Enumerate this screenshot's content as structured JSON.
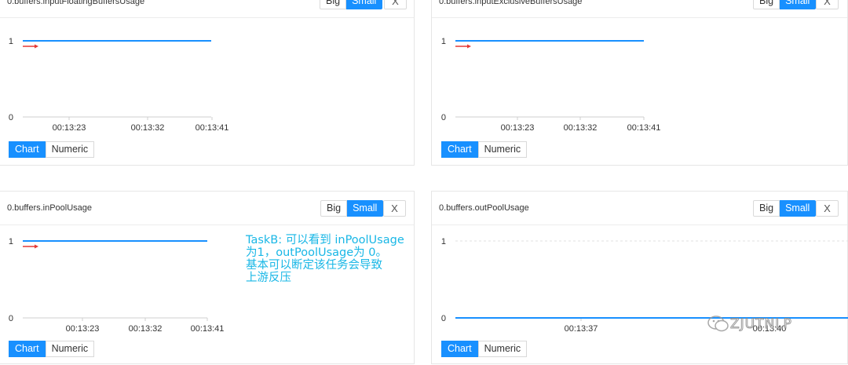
{
  "panels": [
    {
      "title": "0.buffers.inputFloatingBuffersUsage",
      "view_size": {
        "big": "Big",
        "small": "Small",
        "selected": "Small"
      },
      "close": "X",
      "chart_data": {
        "type": "line",
        "y_ticks": [
          "1",
          "0"
        ],
        "x_ticks": [
          "00:13:23",
          "00:13:32",
          "00:13:41"
        ],
        "ylim": [
          0,
          1
        ],
        "series": [
          {
            "values": [
              1,
              1
            ]
          }
        ],
        "line_color": "#1890ff",
        "marker": "red-arrow"
      },
      "view_mode": {
        "chart": "Chart",
        "numeric": "Numeric",
        "selected": "Chart"
      }
    },
    {
      "title": "0.buffers.inputExclusiveBuffersUsage",
      "view_size": {
        "big": "Big",
        "small": "Small",
        "selected": "Small"
      },
      "close": "X",
      "chart_data": {
        "type": "line",
        "y_ticks": [
          "1",
          "0"
        ],
        "x_ticks": [
          "00:13:23",
          "00:13:32",
          "00:13:41"
        ],
        "ylim": [
          0,
          1
        ],
        "series": [
          {
            "values": [
              1,
              1
            ]
          }
        ],
        "line_color": "#1890ff",
        "marker": "red-arrow"
      },
      "view_mode": {
        "chart": "Chart",
        "numeric": "Numeric",
        "selected": "Chart"
      }
    },
    {
      "title": "0.buffers.inPoolUsage",
      "view_size": {
        "big": "Big",
        "small": "Small",
        "selected": "Small"
      },
      "close": "X",
      "chart_data": {
        "type": "line",
        "y_ticks": [
          "1",
          "0"
        ],
        "x_ticks": [
          "00:13:23",
          "00:13:32",
          "00:13:41"
        ],
        "ylim": [
          0,
          1
        ],
        "series": [
          {
            "values": [
              1,
              1
            ]
          }
        ],
        "line_color": "#1890ff",
        "marker": "red-arrow"
      },
      "view_mode": {
        "chart": "Chart",
        "numeric": "Numeric",
        "selected": "Chart"
      }
    },
    {
      "title": "0.buffers.outPoolUsage",
      "view_size": {
        "big": "Big",
        "small": "Small",
        "selected": "Small"
      },
      "close": "X",
      "chart_data": {
        "type": "line",
        "y_ticks": [
          "1",
          "0"
        ],
        "x_ticks": [
          "00:13:37",
          "00:13:40"
        ],
        "ylim": [
          0,
          1
        ],
        "series": [
          {
            "values": [
              0,
              0
            ]
          }
        ],
        "line_color": "#1890ff",
        "marker": "none"
      },
      "view_mode": {
        "chart": "Chart",
        "numeric": "Numeric",
        "selected": "Chart"
      }
    }
  ],
  "annotation": {
    "lines": [
      "TaskB: 可以看到 inPoolUsage",
      " 为1，outPoolUsage为 0。",
      "基本可以断定该任务会导致",
      "上游反压"
    ],
    "color": "#19b7e6"
  },
  "watermark": {
    "text": "ZJUTNLP"
  }
}
